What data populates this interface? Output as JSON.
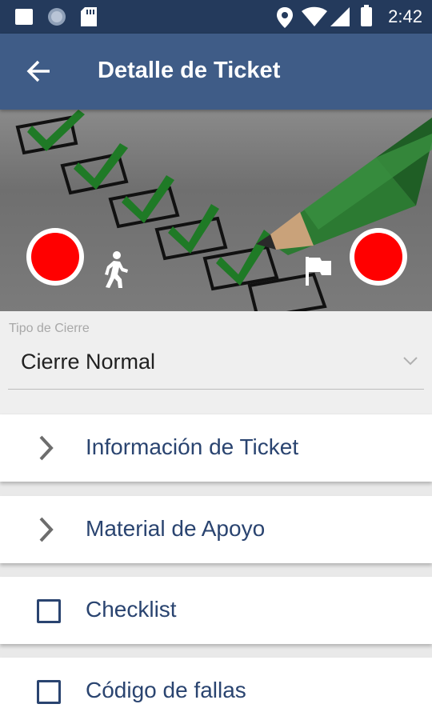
{
  "status_bar": {
    "time": "2:42",
    "icons": [
      "square-notification-icon",
      "circle-notification-icon",
      "sd-card-icon",
      "location-icon",
      "wifi-icon",
      "signal-icon",
      "battery-icon"
    ]
  },
  "toolbar": {
    "title": "Detalle de Ticket",
    "back_icon": "arrow-left-icon"
  },
  "banner": {
    "image": "checklist-pencil-illustration",
    "left_button_icon": "record-icon",
    "walk_icon": "walking-person-icon",
    "flag_icon": "flag-icon",
    "right_button_icon": "record-icon",
    "record_color": "#ff0000"
  },
  "closure": {
    "label": "Tipo de Cierre",
    "value": "Cierre Normal"
  },
  "sections": [
    {
      "label": "Información de Ticket",
      "icon": "chevron-right-icon"
    },
    {
      "label": "Material de Apoyo",
      "icon": "chevron-right-icon"
    },
    {
      "label": "Checklist",
      "icon": "checkbox-icon"
    },
    {
      "label": "Código de fallas",
      "icon": "checkbox-icon"
    }
  ],
  "colors": {
    "status_bar": "#243a5c",
    "toolbar": "#3f5c87",
    "section_text": "#2a4470"
  }
}
